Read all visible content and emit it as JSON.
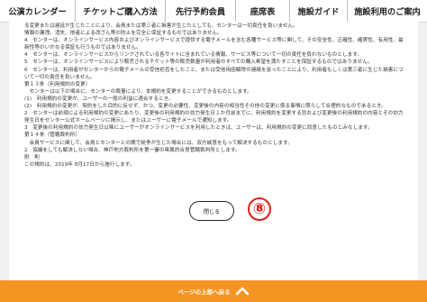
{
  "nav": {
    "items": [
      {
        "label": "公演カレンダー"
      },
      {
        "label": "チケットご購入方法"
      },
      {
        "label": "先行予約会員"
      },
      {
        "label": "座席表"
      },
      {
        "label": "施設ガイド"
      },
      {
        "label": "施設利用のご案内"
      }
    ]
  },
  "terms": {
    "paragraphs": [
      "る変更または遅延が生じたことにより、会員または第三者に損害が生じたとしても、センターは一切責任を負いません。",
      "情報の漏洩、消失、他者による改ざん等の防止を完全に保証するものではありません。",
      "4　センターは、オンラインサービス内容およびオンラインサービスで提供する電子メールを含む各種サービス等に関して、その安全性、正確性、確実性、有用性、最新性等のいかなる保証も行うものではありません。",
      "4　センターは、オンラインサービスからリンクされている各サイトに含まれている情報、サービス等について一切の責任を負わないものとします。",
      "5　センターは、オンラインサービスにより販売されるチケット等の販売数量が利用者のすべての購入希望を満たすことを保証するものではありません。",
      "6　センターは、利用者がセンターからの電子メールの受信拒否をしたこと、または受信用函解除の連絡を怠ったことにより、利用者もしくは第三者に生じた損害について一切の責任を負いません。",
      "第１３条（利用規約の変更）",
      "　センターは以下の場合に、センターの裁量により、本規約を変更することができるものとします。",
      "(1)　利用規約の変更が、ユーザーの一般の利益に適合するとき。",
      "(2)　利用規約の変更が、契約をした目的に反せず、かつ、変更の必要性、変更後の内容の相当性その他の変更に係る事情に照らして合理的なものであるとき。",
      "2　センターは前項による利用規約の変更にあたり、変更後の利用規約の効力発生日１か月前までに、利用規約を変更する旨および変更後の利用規約の内容とその効力発生日をセンター公式ホームページに掲示し、またはユーザーに電子メールで通知します。",
      "3　変更後の利用規約の効力発生日以降にユーザーがオンラインサービスを利用したときは、ユーザーは、利用規約の変更に同意したものとみなします。",
      "第１４条（管轄裁判所）",
      "　会員サービスに関して、会員とセンターとの間で紛争が生じた場合には、双方誠意をもって解決するものとします。",
      "2　協議をしても解決しない場合、神戸地方裁判所を第一審の専属的合意管轄裁判所とします。",
      "",
      "附　則",
      "この規約は、2019年 8月17日から施行します。"
    ]
  },
  "close_button": {
    "label": "閉じる"
  },
  "annotation": {
    "marker": "⑧",
    "color": "#e0211a"
  },
  "footer": {
    "pagetop_label": "ページの上部へ戻る",
    "color": "#f39423"
  }
}
